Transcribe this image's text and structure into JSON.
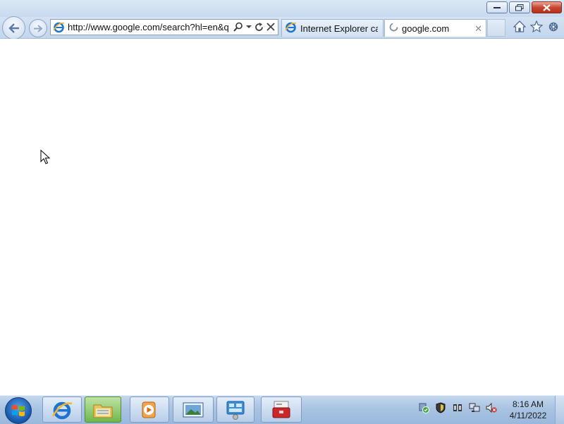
{
  "browser": {
    "address_url": "http://www.google.com/search?hl=en&q=",
    "tabs": [
      {
        "label": "Internet Explorer ca..."
      },
      {
        "label": "google.com"
      }
    ],
    "tab_close_glyph": "✕",
    "icons": {
      "back": "back-arrow-icon",
      "forward": "forward-arrow-icon",
      "search": "search-icon",
      "dropdown": "chevron-down-icon",
      "refresh": "refresh-icon",
      "stop": "stop-icon",
      "home": "home-icon",
      "favorites": "star-icon",
      "tools": "gear-icon"
    }
  },
  "taskbar": {
    "pinned": [
      {
        "name": "internet-explorer"
      },
      {
        "name": "file-explorer"
      },
      {
        "name": "media-player"
      },
      {
        "name": "image-viewer"
      },
      {
        "name": "control-panel"
      },
      {
        "name": "toolbox"
      }
    ],
    "clock": {
      "time": "8:16 AM",
      "date": "4/11/2022"
    }
  },
  "colors": {
    "chrome_bg": "#c9daef",
    "taskbar_bg": "#a9c3e2",
    "close_button": "#c8472f"
  }
}
